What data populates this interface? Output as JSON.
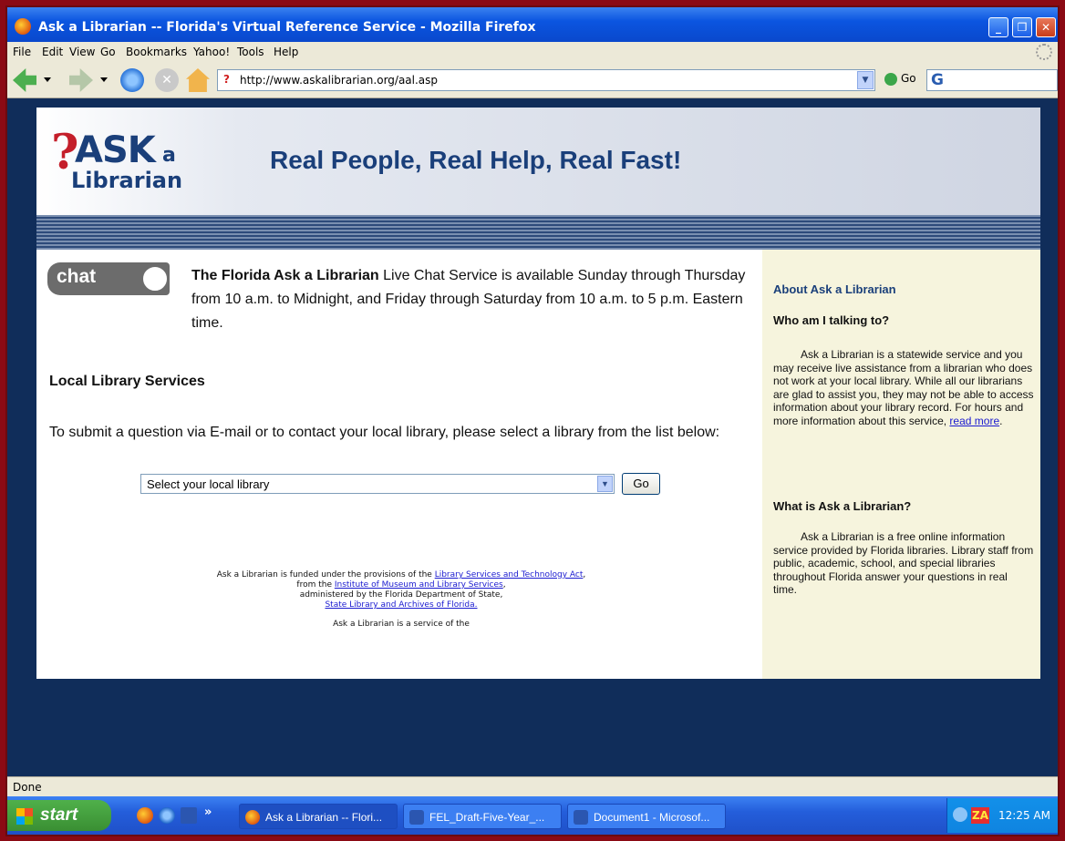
{
  "window": {
    "title": "Ask a Librarian -- Florida's Virtual Reference Service - Mozilla Firefox",
    "controls": {
      "minimize": "_",
      "maximize": "❐",
      "close": "✕"
    }
  },
  "menu": [
    "File",
    "Edit",
    "View",
    "Go",
    "Bookmarks",
    "Yahoo!",
    "Tools",
    "Help"
  ],
  "nav": {
    "url": "http://www.askalibrarian.org/aal.asp",
    "go_label": "Go",
    "site_icon": "?",
    "search_icon": "G"
  },
  "page": {
    "logo": {
      "q": "?",
      "ask": "ASK",
      "a": "a",
      "librarian": "Librarian"
    },
    "tagline": "Real People, Real Help, Real Fast!",
    "chat_label": "chat",
    "chat_bold": "The Florida Ask a Librarian",
    "chat_text": " Live Chat Service is available Sunday through Thursday from 10 a.m. to Midnight, and Friday through Saturday from 10 a.m. to 5 p.m. Eastern time.",
    "local_heading": "Local Library Services",
    "local_text": "To submit a question via E-mail or to contact your local library, please select a library from the list below:",
    "library_select": "Select your local library",
    "go_button": "Go",
    "footer": {
      "line1_pre": "Ask a Librarian is funded under the provisions of the ",
      "line1_link": "Library Services and Technology Act",
      "line1_post": ",",
      "line2_pre": "from the ",
      "line2_link": "Institute of Museum and Library Services",
      "line2_post": ",",
      "line3": "administered by the Florida Department of State,",
      "line4_link": "State Library and Archives of Florida.",
      "service": "Ask a Librarian is a service of the"
    },
    "sidebar": {
      "heading": "About Ask a Librarian",
      "q1": "Who am I talking to?",
      "p1": "Ask a Librarian is a statewide service and you may receive live assistance from a librarian who does not work at your local library. While all our librarians are glad to assist you, they may not be able to access information about your library record. For hours and more information about this service, ",
      "p1_link": "read more",
      "p1_end": ".",
      "q2": "What is Ask a Librarian?",
      "p2": "Ask a Librarian is a free online information service provided by Florida libraries. Library staff from public, academic, school, and special libraries throughout Florida answer your questions in real time."
    }
  },
  "status": "Done",
  "taskbar": {
    "start": "start",
    "overflow": "»",
    "tasks": [
      "Ask a Librarian -- Flori...",
      "FEL_Draft-Five-Year_...",
      "Document1 - Microsof..."
    ],
    "tray_badge": "ZA",
    "clock": "12:25 AM"
  },
  "colors": {
    "accent": "#1a3f7a",
    "sidebar_bg": "#f6f4dd",
    "frame": "#8b0a14"
  }
}
